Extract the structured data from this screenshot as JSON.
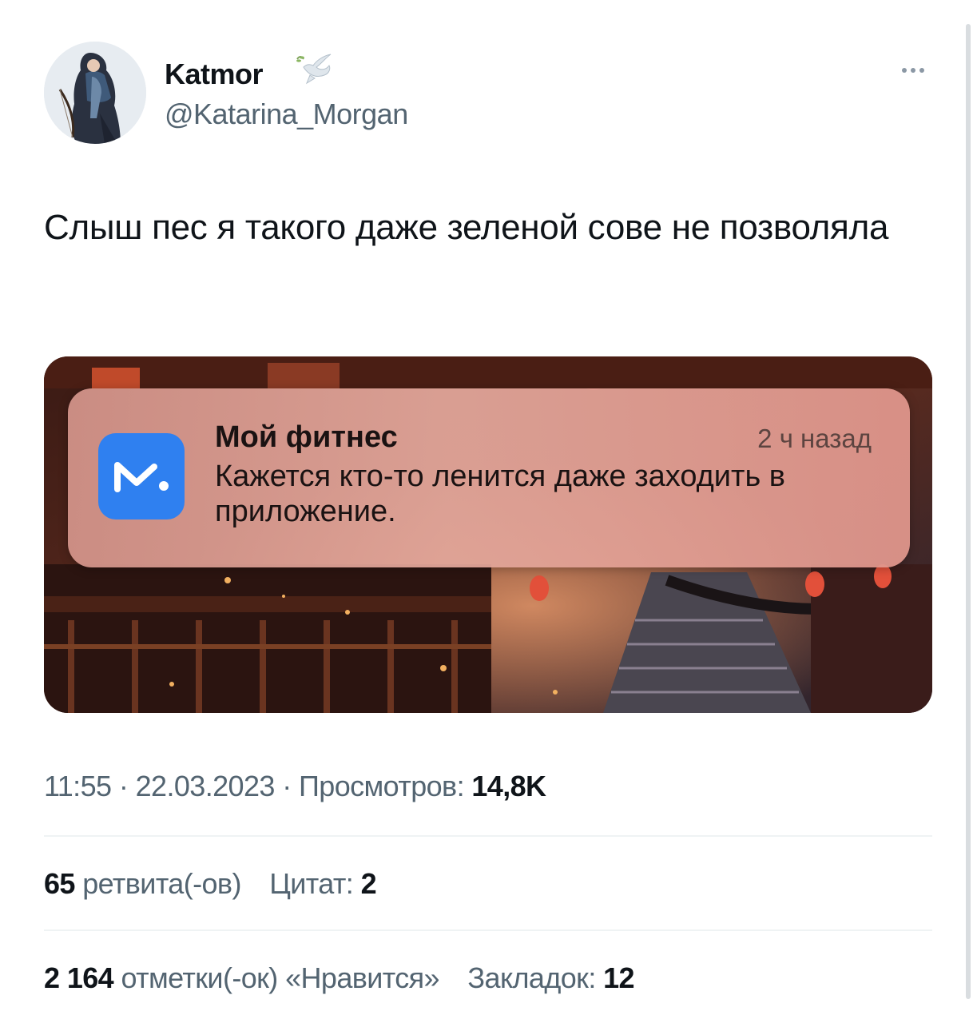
{
  "author": {
    "display_name": "Katmor",
    "handle": "@Katarina_Morgan",
    "badge_icon": "dove-icon",
    "avatar_icon": "avatar-archer-image"
  },
  "more_icon": "more-dots-icon",
  "tweet": {
    "text": "Слыш пес я такого даже зеленой сове не позволяла"
  },
  "media": {
    "background": "fantasy-city-night-image",
    "notification": {
      "app_name": "Мой фитнес",
      "time": "2 ч назад",
      "body": "Кажется кто-то ленится даже заходить в приложение.",
      "icon": "mail-app-icon",
      "icon_color": "#2f80f0"
    }
  },
  "meta": {
    "time": "11:55",
    "separator": "·",
    "date": "22.03.2023",
    "views_label": "Просмотров:",
    "views_value": "14,8K"
  },
  "stats": {
    "retweets_value": "65",
    "retweets_label": "ретвита(-ов)",
    "quotes_label": "Цитат:",
    "quotes_value": "2",
    "likes_value": "2 164",
    "likes_label": "отметки(-ок) «Нравится»",
    "bookmarks_label": "Закладок:",
    "bookmarks_value": "12"
  },
  "colors": {
    "text": "#0f1419",
    "secondary": "#536471",
    "divider": "#eff3f4"
  }
}
